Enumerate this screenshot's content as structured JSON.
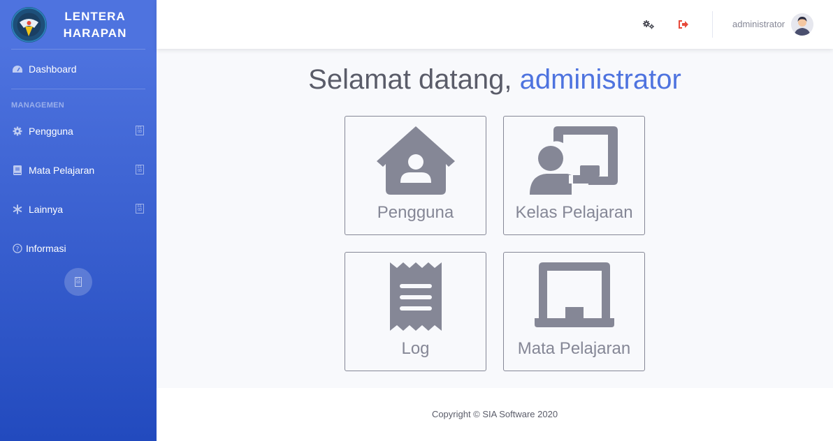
{
  "brand": {
    "line1": "LENTERA",
    "line2": "HARAPAN",
    "logo_text": "LENTERA HARAPAN"
  },
  "sidebar": {
    "dashboard": "Dashboard",
    "heading": "MANAGEMEN",
    "items": [
      {
        "label": "Pengguna",
        "icon": "gear-icon"
      },
      {
        "label": "Mata Pelajaran",
        "icon": "book-icon"
      },
      {
        "label": "Lainnya",
        "icon": "asterisk-icon"
      }
    ],
    "info": "Informasi"
  },
  "topbar": {
    "username": "administrator"
  },
  "main": {
    "welcome_prefix": "Selamat datang,",
    "welcome_name": "administrator",
    "cards": [
      {
        "label": "Pengguna",
        "icon": "house-user-icon"
      },
      {
        "label": "Kelas Pelajaran",
        "icon": "chalkboard-teacher-icon"
      },
      {
        "label": "Log",
        "icon": "receipt-icon"
      },
      {
        "label": "Mata Pelajaran",
        "icon": "laptop-icon"
      }
    ]
  },
  "footer": {
    "copyright": "Copyright © SIA Software 2020"
  },
  "colors": {
    "primary": "#4e73df",
    "logout": "#e74a3b",
    "muted": "#858796",
    "text": "#5a5c69"
  }
}
